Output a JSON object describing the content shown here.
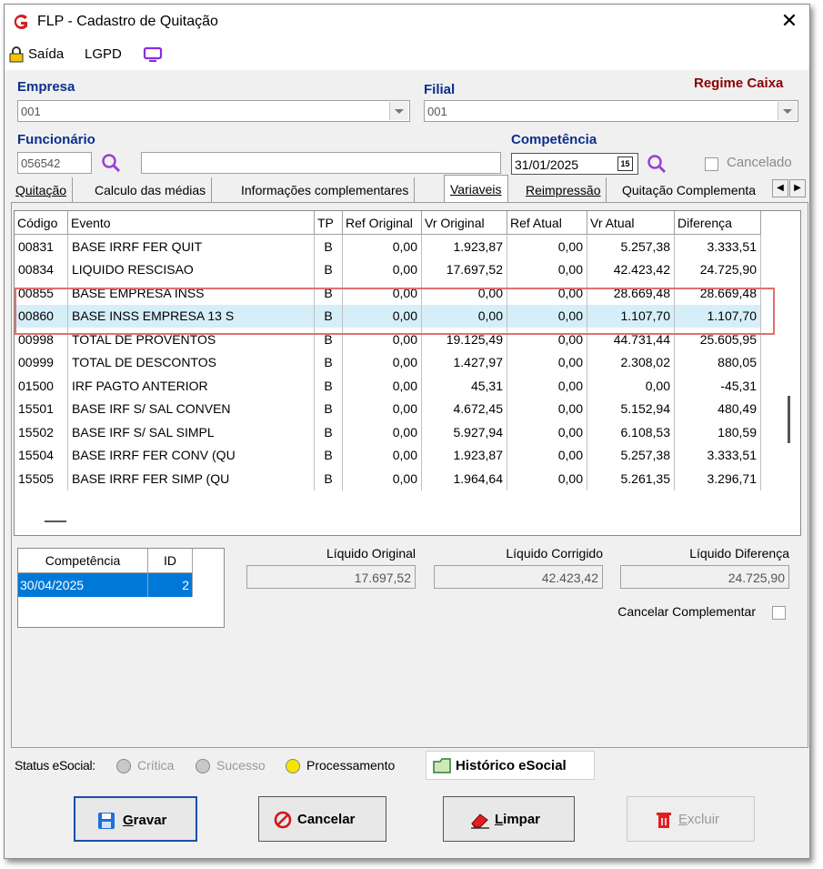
{
  "window": {
    "title": "FLP - Cadastro de Quitação"
  },
  "menu": {
    "exit_label": "Saída",
    "lgpd_label": "LGPD"
  },
  "company": {
    "label": "Empresa",
    "value": "001"
  },
  "branch": {
    "label": "Filial",
    "value": "001"
  },
  "regime": "Regime Caixa",
  "employee": {
    "label": "Funcionário",
    "code": "056542",
    "name": ""
  },
  "competence": {
    "label": "Competência",
    "value": "31/01/2025"
  },
  "cancelled_label": "Cancelado",
  "calendar_badge": "15",
  "tabs": [
    {
      "label": "Quitação"
    },
    {
      "label": "Calculo das médias"
    },
    {
      "label": "Informações complementares"
    },
    {
      "label": "Variaveis"
    },
    {
      "label": "Reimpressão"
    },
    {
      "label": "Quitação Complementa"
    }
  ],
  "active_tab": "Variaveis",
  "grid": {
    "columns": [
      "Código",
      "Evento",
      "TP",
      "Ref Original",
      "Vr Original",
      "Ref Atual",
      "Vr Atual",
      "Diferença"
    ],
    "rows": [
      [
        "00831",
        "BASE IRRF FER QUIT",
        "B",
        "0,00",
        "1.923,87",
        "0,00",
        "5.257,38",
        "3.333,51"
      ],
      [
        "00834",
        "LIQUIDO RESCISAO",
        "B",
        "0,00",
        "17.697,52",
        "0,00",
        "42.423,42",
        "24.725,90"
      ],
      [
        "00855",
        "BASE EMPRESA INSS",
        "B",
        "0,00",
        "0,00",
        "0,00",
        "28.669,48",
        "28.669,48"
      ],
      [
        "00860",
        "BASE INSS EMPRESA 13 S",
        "B",
        "0,00",
        "0,00",
        "0,00",
        "1.107,70",
        "1.107,70"
      ],
      [
        "00998",
        "TOTAL DE PROVENTOS",
        "B",
        "0,00",
        "19.125,49",
        "0,00",
        "44.731,44",
        "25.605,95"
      ],
      [
        "00999",
        "TOTAL DE DESCONTOS",
        "B",
        "0,00",
        "1.427,97",
        "0,00",
        "2.308,02",
        "880,05"
      ],
      [
        "01500",
        "IRF PAGTO ANTERIOR",
        "B",
        "0,00",
        "45,31",
        "0,00",
        "0,00",
        "-45,31"
      ],
      [
        "15501",
        "BASE IRF S/ SAL CONVEN",
        "B",
        "0,00",
        "4.672,45",
        "0,00",
        "5.152,94",
        "480,49"
      ],
      [
        "15502",
        "BASE IRF S/ SAL SIMPL",
        "B",
        "0,00",
        "5.927,94",
        "0,00",
        "6.108,53",
        "180,59"
      ],
      [
        "15504",
        "BASE IRRF FER CONV (QU",
        "B",
        "0,00",
        "1.923,87",
        "0,00",
        "5.257,38",
        "3.333,51"
      ],
      [
        "15505",
        "BASE IRRF FER SIMP (QU",
        "B",
        "0,00",
        "1.964,64",
        "0,00",
        "5.261,35",
        "3.296,71"
      ]
    ],
    "selected_row_index": 3
  },
  "competence_list": {
    "columns": [
      "Competência",
      "ID"
    ],
    "rows": [
      [
        "30/04/2025",
        "2"
      ]
    ]
  },
  "totals": {
    "original_label": "Líquido Original",
    "original_value": "17.697,52",
    "corrected_label": "Líquido Corrigido",
    "corrected_value": "42.423,42",
    "difference_label": "Líquido Diferença",
    "difference_value": "24.725,90"
  },
  "cancel_complementary_label": "Cancelar Complementar",
  "status": {
    "label": "Status eSocial:",
    "critical_label": "Crítica",
    "success_label": "Sucesso",
    "processing_label": "Processamento",
    "history_label": "Histórico eSocial"
  },
  "buttons": {
    "save_first": "G",
    "save_rest": "ravar",
    "cancel": "Cancelar",
    "clear_first": "L",
    "clear_rest": "impar",
    "delete_first": "E",
    "delete_rest": "xcluir"
  },
  "colors": {
    "label_blue": "#0a2f8c",
    "regime_red": "#8b0000",
    "selection_blue": "#0078d7",
    "highlight_red": "#e07070"
  }
}
